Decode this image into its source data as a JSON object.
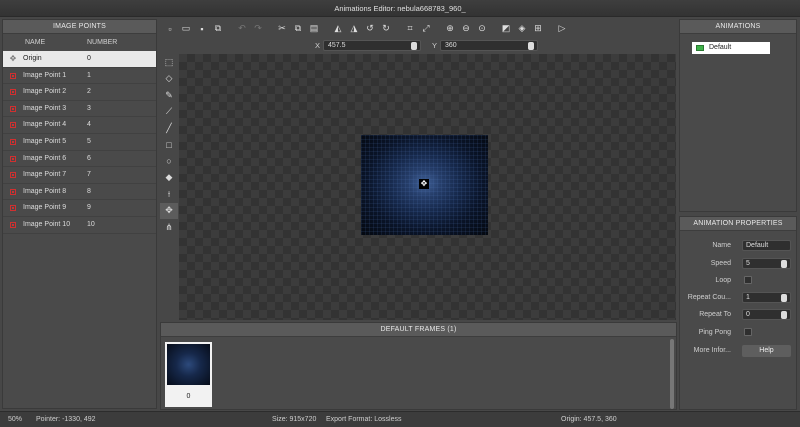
{
  "window": {
    "title": "Animations Editor: nebula668783_960_"
  },
  "image_points": {
    "header": "IMAGE POINTS",
    "col_name": "NAME",
    "col_number": "NUMBER",
    "rows": [
      {
        "name": "Origin",
        "number": "0",
        "selected": true
      },
      {
        "name": "Image Point 1",
        "number": "1"
      },
      {
        "name": "Image Point 2",
        "number": "2"
      },
      {
        "name": "Image Point 3",
        "number": "3"
      },
      {
        "name": "Image Point 4",
        "number": "4"
      },
      {
        "name": "Image Point 5",
        "number": "5"
      },
      {
        "name": "Image Point 6",
        "number": "6"
      },
      {
        "name": "Image Point 7",
        "number": "7"
      },
      {
        "name": "Image Point 8",
        "number": "8"
      },
      {
        "name": "Image Point 9",
        "number": "9"
      },
      {
        "name": "Image Point 10",
        "number": "10"
      }
    ]
  },
  "toolbar": {
    "icons": [
      "new-file-icon",
      "open-folder-icon",
      "save-icon",
      "export-icon",
      "undo-icon",
      "redo-icon",
      "cut-icon",
      "copy-icon",
      "paste-icon",
      "flip-horizontal-icon",
      "flip-vertical-icon",
      "rotate-ccw-icon",
      "rotate-cw-icon",
      "crop-icon",
      "resize-icon",
      "zoom-in-icon",
      "zoom-out-icon",
      "zoom-reset-icon",
      "background-icon",
      "layers-icon",
      "grid-icon",
      "play-icon"
    ]
  },
  "coords": {
    "x_label": "X",
    "x_value": "457.5",
    "y_label": "Y",
    "y_value": "360"
  },
  "tools": [
    "select-tool-icon",
    "eraser-icon",
    "pencil-icon",
    "brush-icon",
    "line-icon",
    "rectangle-icon",
    "ellipse-icon",
    "fill-icon",
    "eyedropper-icon",
    "origin-tool-icon",
    "mesh-tool-icon"
  ],
  "frames": {
    "header": "DEFAULT FRAMES (1)",
    "items": [
      {
        "number": "0"
      }
    ]
  },
  "animations": {
    "header": "ANIMATIONS",
    "items": [
      {
        "name": "Default"
      }
    ]
  },
  "properties": {
    "header": "ANIMATION PROPERTIES",
    "name_label": "Name",
    "name_value": "Default",
    "speed_label": "Speed",
    "speed_value": "5",
    "loop_label": "Loop",
    "repeat_count_label": "Repeat Cou...",
    "repeat_count_value": "1",
    "repeat_to_label": "Repeat To",
    "repeat_to_value": "0",
    "ping_pong_label": "Ping Pong",
    "more_info_label": "More Infor...",
    "help_label": "Help"
  },
  "status": {
    "zoom": "50%",
    "pointer": "Pointer: -1330, 492",
    "size": "Size: 915x720",
    "export_format": "Export Format: Lossless",
    "origin": "Origin: 457.5, 360"
  }
}
